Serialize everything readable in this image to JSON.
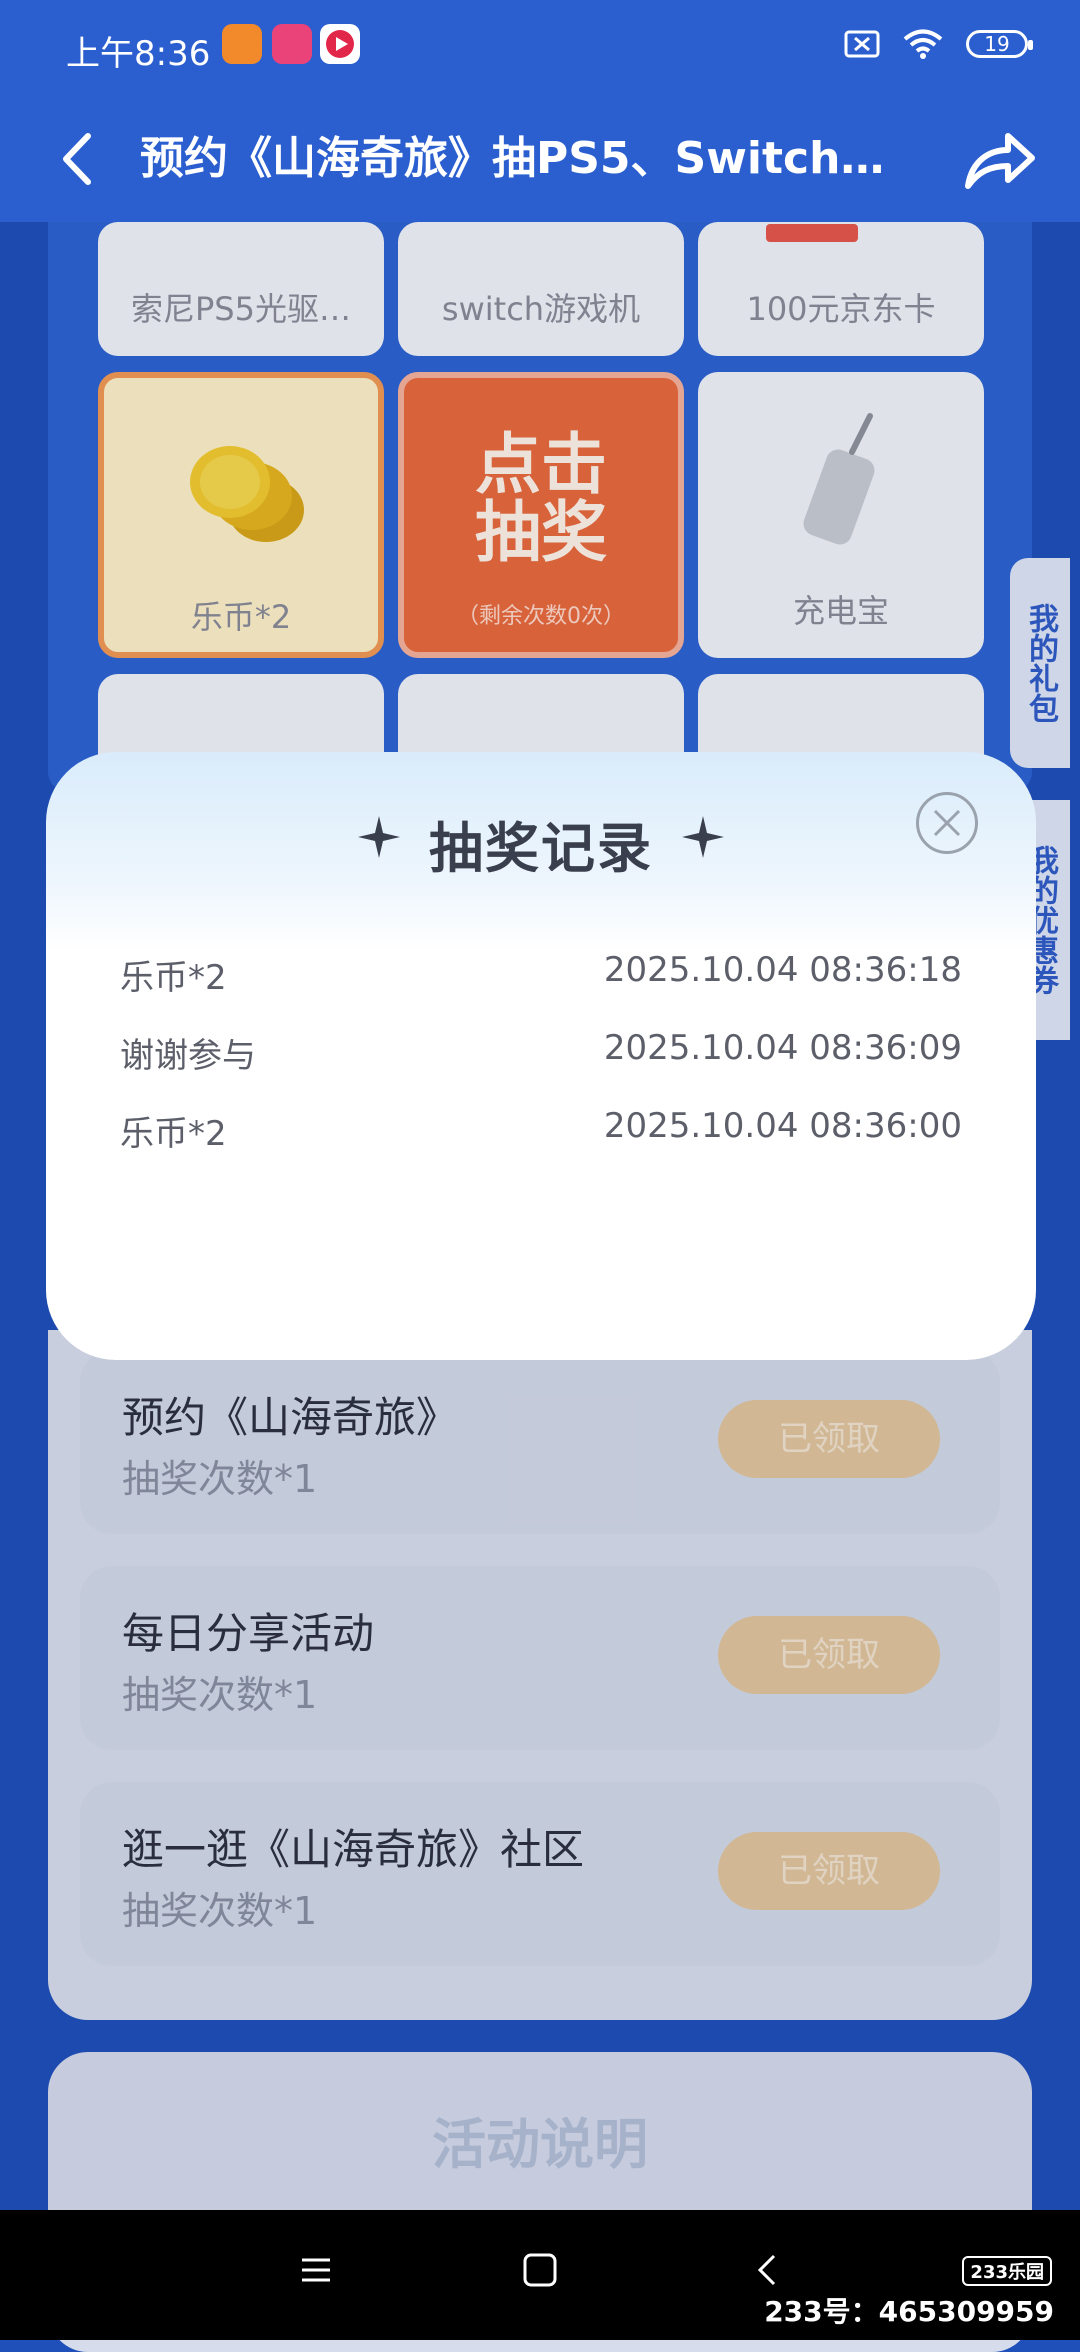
{
  "status": {
    "time": "上午8:36",
    "battery": "19"
  },
  "header": {
    "title": "预约《山海奇旅》抽PS5、Switch…"
  },
  "prizes": {
    "row1": [
      "索尼PS5光驱…",
      "switch游戏机",
      "100元京东卡"
    ],
    "row2_left": "乐币*2",
    "draw_button": "点击\n抽奖",
    "draw_line1": "点击",
    "draw_line2": "抽奖",
    "draw_remaining": "（剩余次数0次）",
    "row2_right": "充电宝"
  },
  "side_tabs": {
    "gifts": "我的礼包",
    "coupons": "我的优惠券"
  },
  "modal": {
    "title": "抽奖记录",
    "records": [
      {
        "name": "乐币*2",
        "time": "2025.10.04 08:36:18"
      },
      {
        "name": "谢谢参与",
        "time": "2025.10.04 08:36:09"
      },
      {
        "name": "乐币*2",
        "time": "2025.10.04 08:36:00"
      }
    ]
  },
  "tasks": [
    {
      "title": "预约《山海奇旅》",
      "sub": "抽奖次数*1",
      "button": "已领取"
    },
    {
      "title": "每日分享活动",
      "sub": "抽奖次数*1",
      "button": "已领取"
    },
    {
      "title": "逛一逛《山海奇旅》社区",
      "sub": "抽奖次数*1",
      "button": "已领取"
    }
  ],
  "rules": {
    "title": "活动说明"
  },
  "watermark": {
    "logo": "233乐园",
    "text": "233号：465309959"
  },
  "colors": {
    "header_blue": "#2b5fd0",
    "draw_orange": "#ea6a3b"
  }
}
